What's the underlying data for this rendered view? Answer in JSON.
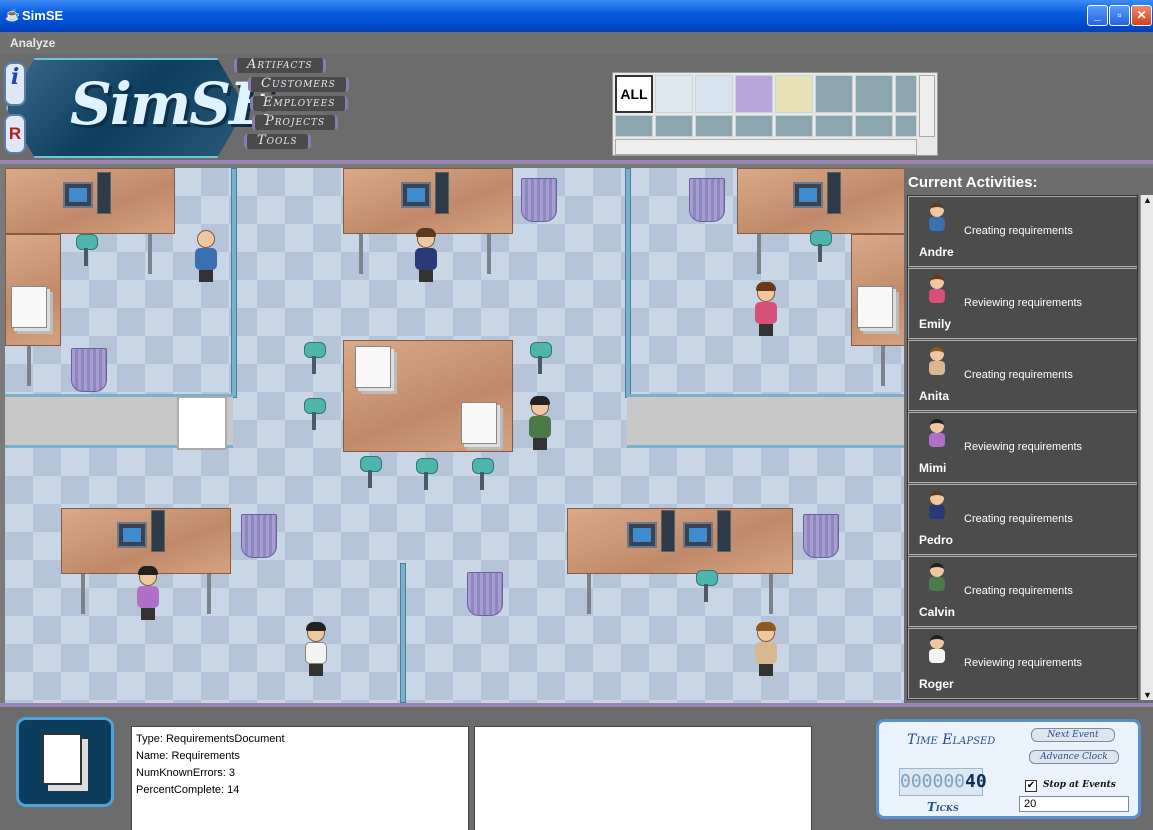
{
  "window": {
    "title": "SimSE",
    "minimize": "_",
    "maximize": "▫",
    "close": "✕"
  },
  "menu": {
    "analyze": "Analyze"
  },
  "nav": {
    "artifacts": "Artifacts",
    "customers": "Customers",
    "employees": "Employees",
    "projects": "Projects",
    "tools": "Tools"
  },
  "logo": {
    "text": "SimSE"
  },
  "side_icons": {
    "info": "i",
    "rules": "R"
  },
  "object_grid": {
    "all_label": "ALL"
  },
  "activities": {
    "title": "Current Activities:",
    "items": [
      {
        "name": "Andre",
        "activity": "Creating requirements",
        "shirt": "#3a6fb0",
        "hair": "#5a3a20"
      },
      {
        "name": "Emily",
        "activity": "Reviewing requirements",
        "shirt": "#d8507a",
        "hair": "#6a3a18"
      },
      {
        "name": "Anita",
        "activity": "Creating requirements",
        "shirt": "#d8b890",
        "hair": "#8a5a20"
      },
      {
        "name": "Mimi",
        "activity": "Reviewing requirements",
        "shirt": "#b070c8",
        "hair": "#222222"
      },
      {
        "name": "Pedro",
        "activity": "Creating requirements",
        "shirt": "#2a3a78",
        "hair": "#5a3a20"
      },
      {
        "name": "Calvin",
        "activity": "Creating requirements",
        "shirt": "#4a7a48",
        "hair": "#222222"
      },
      {
        "name": "Roger",
        "activity": "Reviewing requirements",
        "shirt": "#f4f4f4",
        "hair": "#222222"
      }
    ]
  },
  "selected_object": {
    "type": "Type: RequirementsDocument",
    "name": "Name: Requirements",
    "errors": "NumKnownErrors: 3",
    "percent": "PercentComplete: 14"
  },
  "clock": {
    "title": "Time Elapsed",
    "ticks_dim": "000000",
    "ticks_value": "40",
    "ticks_label": "Ticks",
    "next_event": "Next Event",
    "advance_clock": "Advance Clock",
    "stop_at_events": "Stop at Events",
    "stop_checked": "✔",
    "advance_amount": "20"
  }
}
